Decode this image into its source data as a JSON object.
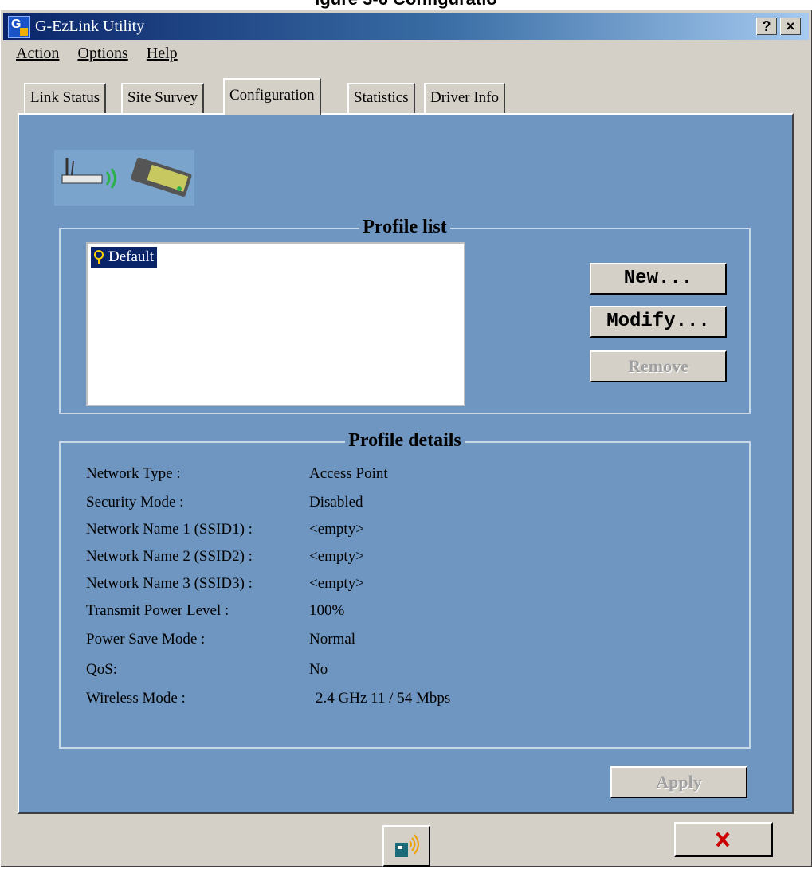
{
  "caption": "igure 3-6 Configuratio",
  "window": {
    "title": "G-EzLink Utility",
    "icon_letter": "G",
    "help_button": "?",
    "close_button": "×"
  },
  "menu": [
    "Action",
    "Options",
    "Help"
  ],
  "tabs": [
    "Link Status",
    "Site Survey",
    "Configuration",
    "Statistics",
    "Driver Info"
  ],
  "active_tab": "Configuration",
  "profile_list": {
    "title": "Profile list",
    "items": [
      "Default"
    ],
    "selected": "Default"
  },
  "buttons": {
    "new": "New...",
    "modify": "Modify...",
    "remove": "Remove",
    "apply": "Apply"
  },
  "profile_details": {
    "title": "Profile details",
    "rows": [
      {
        "label": "Network Type :",
        "value": "Access Point"
      },
      {
        "label": "Security Mode :",
        "value": "Disabled"
      },
      {
        "label": "Network Name 1 (SSID1) :",
        "value": "<empty>"
      },
      {
        "label": "Network Name 2 (SSID2) :",
        "value": "<empty>"
      },
      {
        "label": "Network Name 3 (SSID3) :",
        "value": "<empty>"
      },
      {
        "label": "Transmit Power Level :",
        "value": "100%"
      },
      {
        "label": "Power Save Mode :",
        "value": "Normal"
      },
      {
        "label": "QoS:",
        "value": "No"
      },
      {
        "label": "Wireless Mode :",
        "value": "2.4 GHz  11 / 54 Mbps"
      }
    ]
  },
  "icons": {
    "app": "g-ezlink-app-icon",
    "router": "router-icon",
    "wifi_card": "wifi-card-icon",
    "profile": "profile-icon",
    "bottom_left": "wireless-card-icon",
    "bottom_right": "close-x-icon"
  },
  "colors": {
    "panel": "#6e96c0",
    "dialog": "#d4d0c8",
    "selection": "#0a246a",
    "close_x": "#cc0000"
  }
}
